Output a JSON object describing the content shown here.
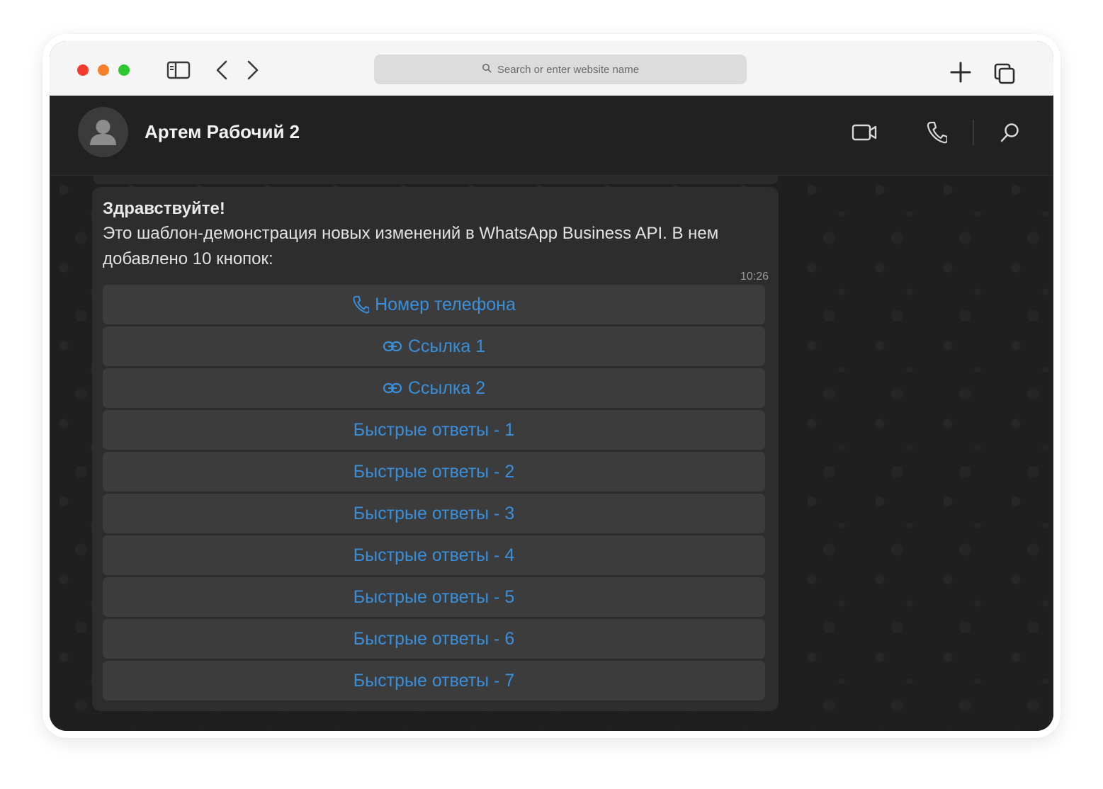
{
  "browser": {
    "address_placeholder": "Search or enter website name",
    "icons": [
      "sidebar-icon",
      "chevron-left-icon",
      "chevron-right-icon",
      "search-icon",
      "plus-icon",
      "tabs-icon"
    ]
  },
  "chat": {
    "contact_name": "Артем Рабочий 2",
    "header_icons": [
      "video-icon",
      "phone-icon",
      "search-icon"
    ]
  },
  "message": {
    "title": "Здравствуйте!",
    "body": "Это шаблон-демонстрация новых изменений в WhatsApp Business API. В нем добавлено 10 кнопок:",
    "time": "10:26",
    "buttons": [
      {
        "label": "Номер телефона",
        "icon": "phone-icon"
      },
      {
        "label": "Ссылка 1",
        "icon": "link-icon"
      },
      {
        "label": "Ссылка 2",
        "icon": "link-icon"
      },
      {
        "label": "Быстрые ответы - 1"
      },
      {
        "label": "Быстрые ответы - 2"
      },
      {
        "label": "Быстрые ответы - 3"
      },
      {
        "label": "Быстрые ответы - 4"
      },
      {
        "label": "Быстрые ответы - 5"
      },
      {
        "label": "Быстрые ответы - 6"
      },
      {
        "label": "Быстрые ответы - 7"
      }
    ]
  },
  "colors": {
    "accent_blue": "#3a8fdb",
    "traffic_red": "#f33a2c",
    "traffic_orange": "#f97f2b",
    "traffic_green": "#2bc82f",
    "chat_bg": "#1f1f1f",
    "bubble_bg": "#2d2d2d",
    "button_bg": "#3c3c3c"
  }
}
